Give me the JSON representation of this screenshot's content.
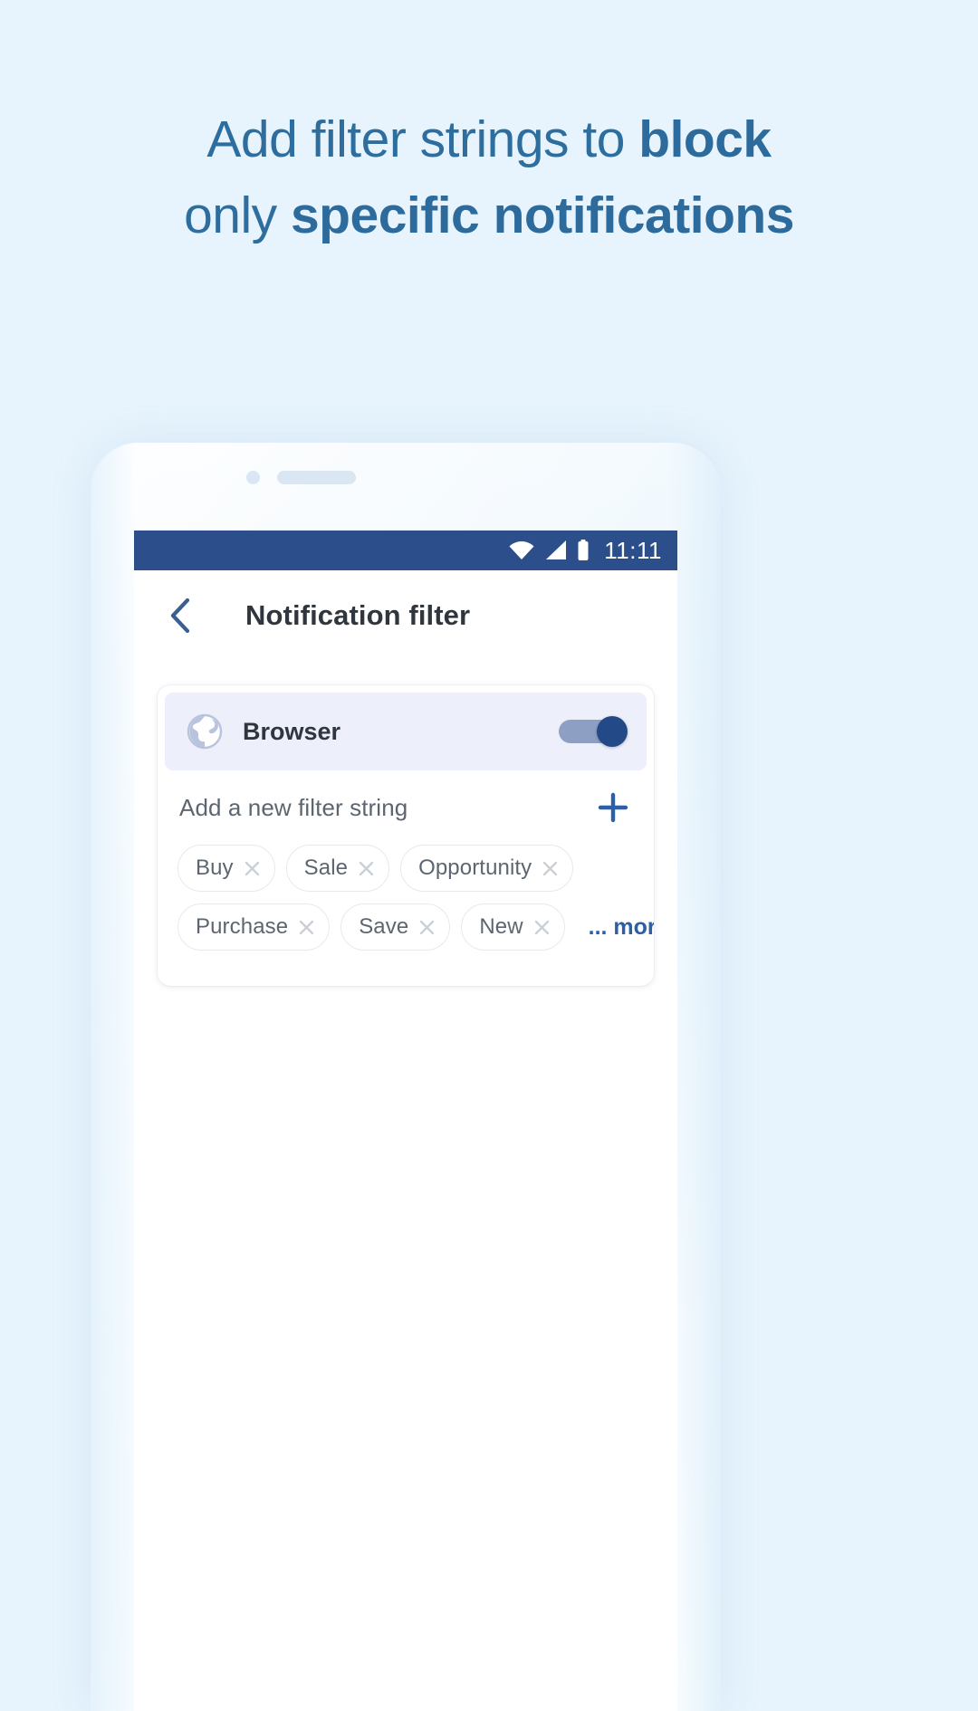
{
  "headline": {
    "line1_plain": "Add filter strings to ",
    "line1_strong": "block",
    "line2_plain": "only ",
    "line2_strong": "specific notifications"
  },
  "colors": {
    "page_background": "#e7f4fd",
    "headline": "#2e6e9e",
    "statusbar": "#2c4f8c",
    "accent": "#2b5fa8",
    "app_row_background": "#edeffb",
    "toggle_knob": "#234a86",
    "toggle_track": "#8e9fc4"
  },
  "phone": {
    "statusbar": {
      "time": "11:11",
      "icons": [
        "wifi-icon",
        "signal-icon",
        "battery-icon"
      ]
    },
    "appbar": {
      "back_icon": "chevron-left-icon",
      "title": "Notification filter"
    },
    "card": {
      "app_row": {
        "icon": "globe-icon",
        "name": "Browser",
        "toggle_state": "on"
      },
      "add_row": {
        "label": "Add a new filter string",
        "plus_icon": "plus-icon"
      },
      "chips": [
        {
          "label": "Buy",
          "remove_icon": "close-icon"
        },
        {
          "label": "Sale",
          "remove_icon": "close-icon"
        },
        {
          "label": "Opportunity",
          "remove_icon": "close-icon"
        },
        {
          "label": "Purchase",
          "remove_icon": "close-icon"
        },
        {
          "label": "Save",
          "remove_icon": "close-icon"
        },
        {
          "label": "New",
          "remove_icon": "close-icon"
        }
      ],
      "more_label": "... more"
    }
  }
}
